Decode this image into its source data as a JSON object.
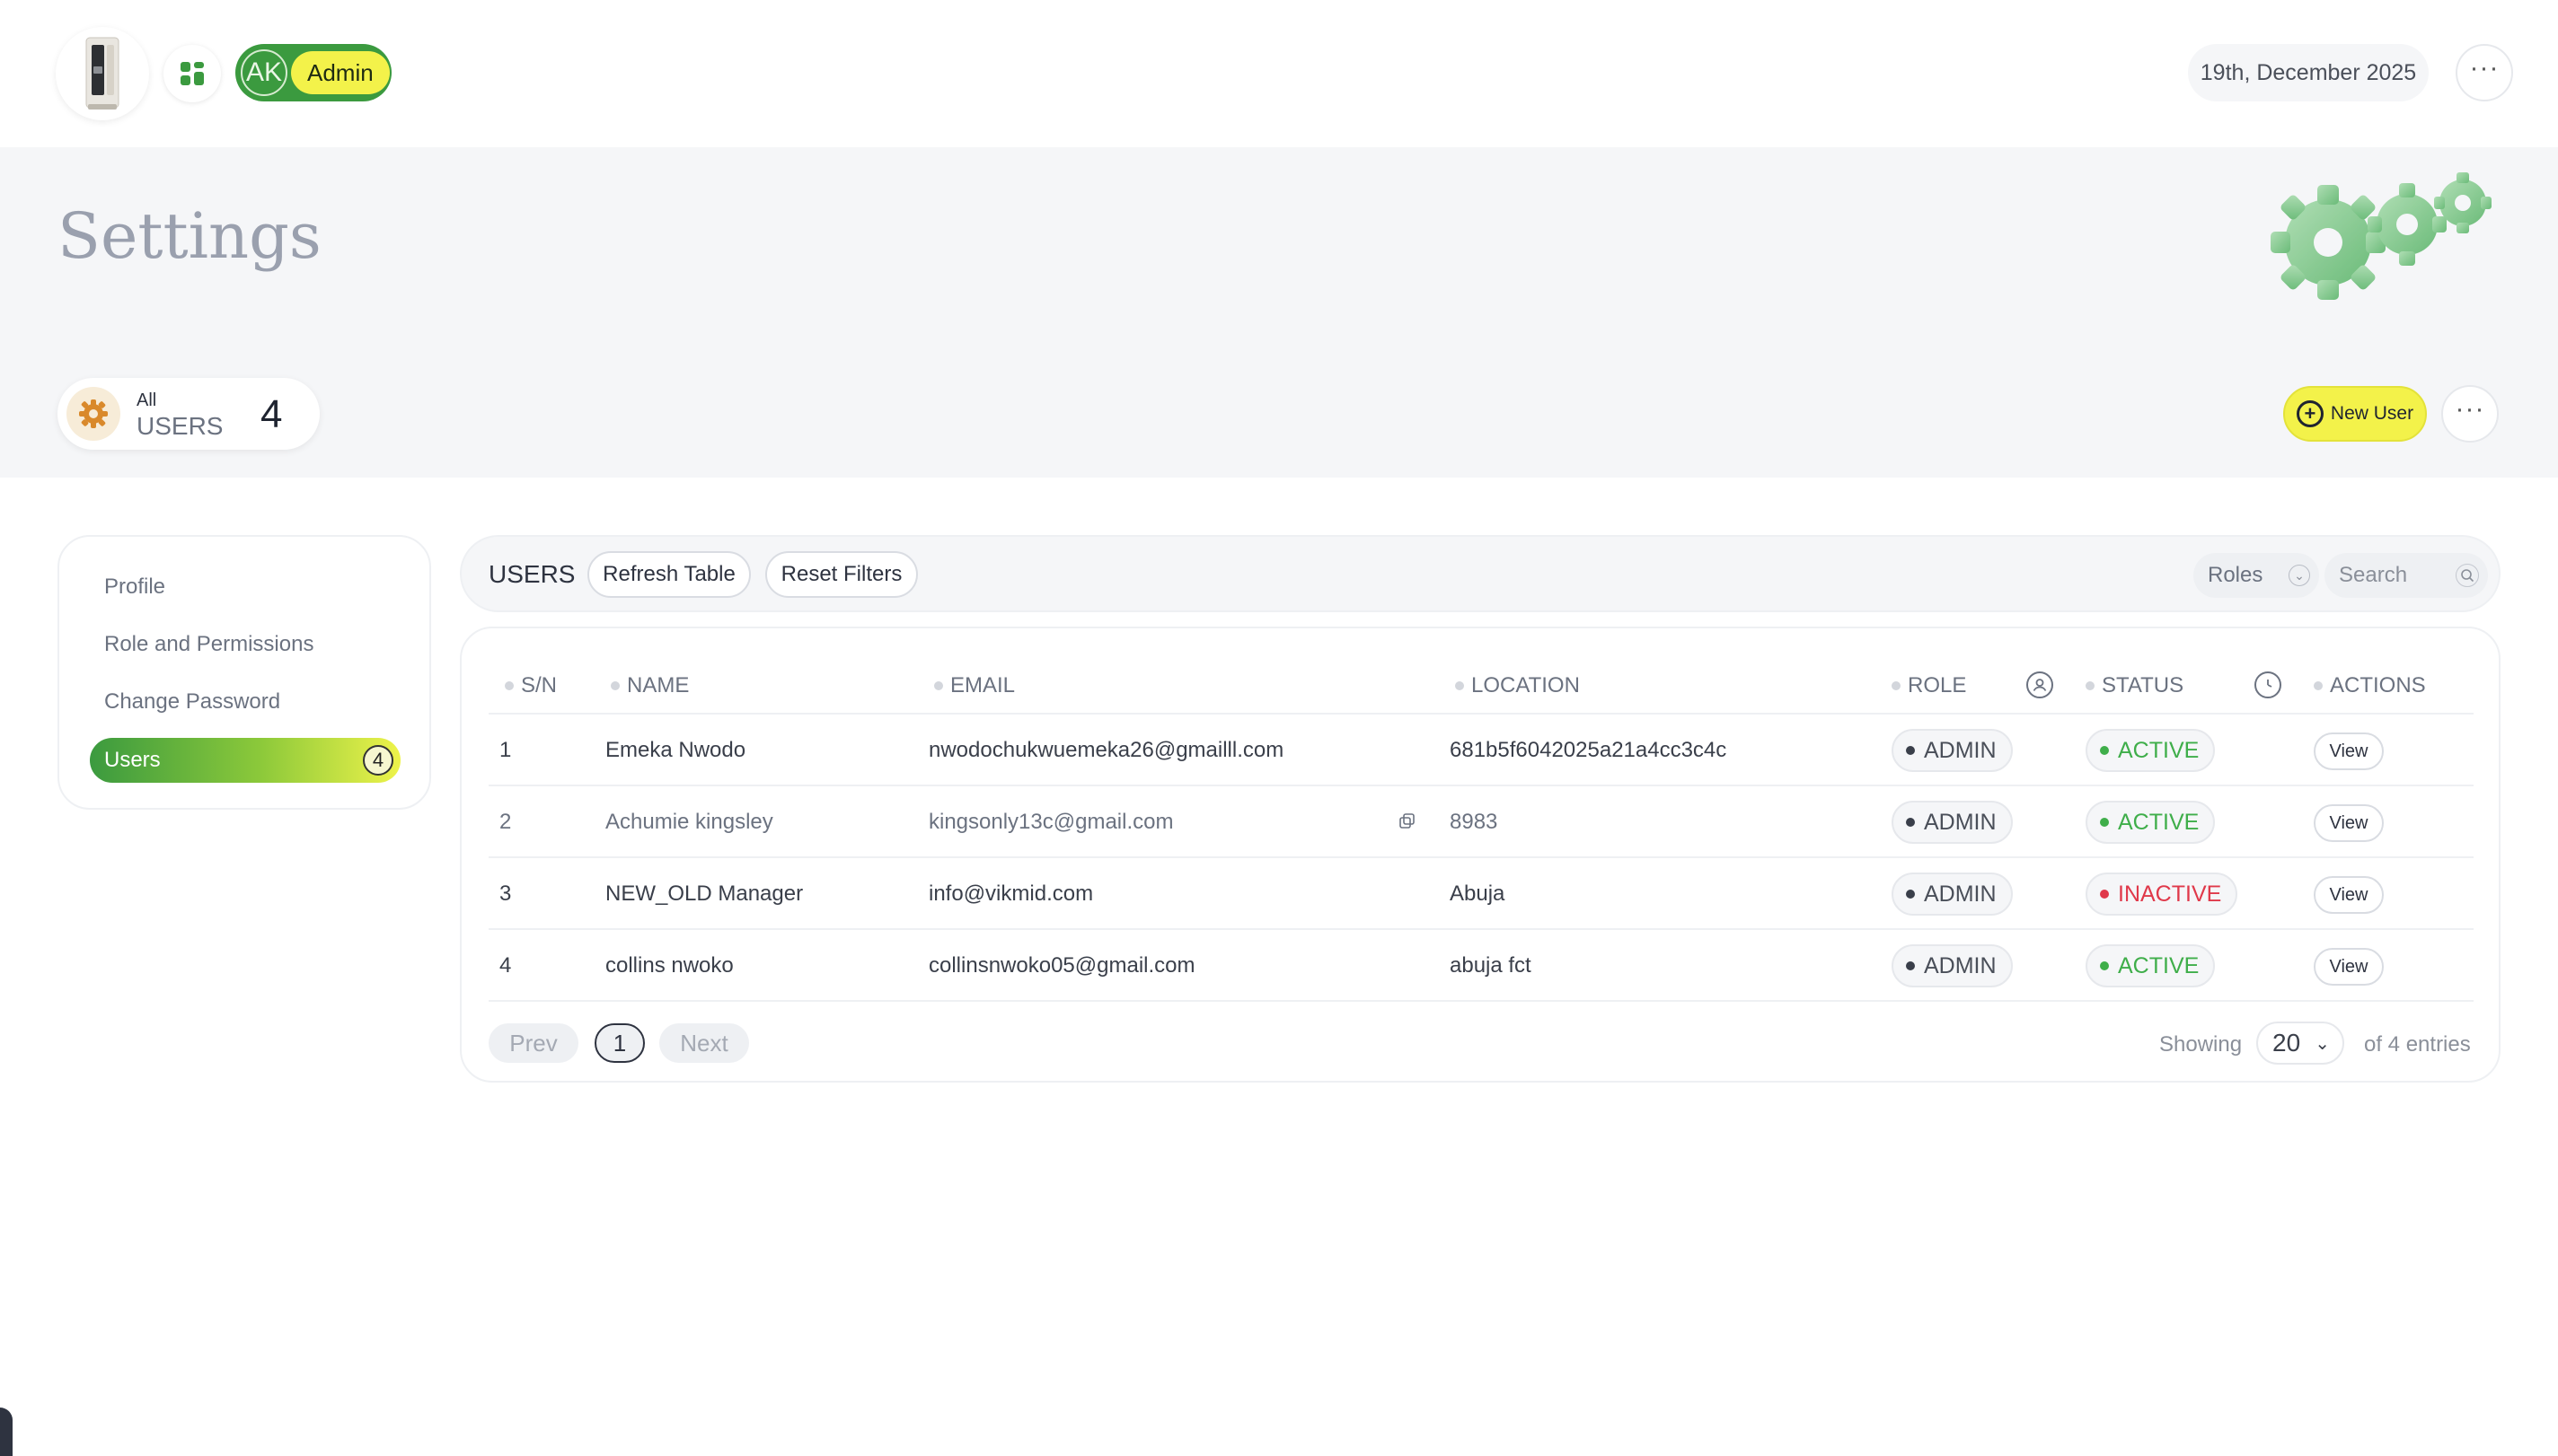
{
  "header": {
    "user_initials": "AK",
    "role_label": "Admin",
    "date": "19th, December 2025"
  },
  "hero": {
    "title": "Settings"
  },
  "summary": {
    "small_label": "All",
    "big_label": "USERS",
    "count": "4",
    "new_user_label": "New User"
  },
  "sidebar": {
    "items": [
      {
        "label": "Profile"
      },
      {
        "label": "Role and Permissions"
      },
      {
        "label": "Change Password"
      },
      {
        "label": "Users",
        "badge": "4",
        "active": true
      }
    ]
  },
  "toolbar": {
    "title": "USERS",
    "refresh_label": "Refresh Table",
    "reset_label": "Reset Filters",
    "roles_label": "Roles",
    "search_placeholder": "Search"
  },
  "table": {
    "columns": [
      "S/N",
      "NAME",
      "EMAIL",
      "LOCATION",
      "ROLE",
      "STATUS",
      "ACTIONS"
    ],
    "rows": [
      {
        "sn": "1",
        "name": "Emeka Nwodo",
        "email": "nwodochukwuemeka26@gmailll.com",
        "location": "681b5f6042025a21a4cc3c4c",
        "role": "ADMIN",
        "status": "ACTIVE",
        "action": "View"
      },
      {
        "sn": "2",
        "name": "Achumie kingsley",
        "email": "kingsonly13c@gmail.com",
        "location": "8983",
        "role": "ADMIN",
        "status": "ACTIVE",
        "action": "View"
      },
      {
        "sn": "3",
        "name": "NEW_OLD Manager",
        "email": "info@vikmid.com",
        "location": "Abuja",
        "role": "ADMIN",
        "status": "INACTIVE",
        "action": "View"
      },
      {
        "sn": "4",
        "name": "collins nwoko",
        "email": "collinsnwoko05@gmail.com",
        "location": "abuja fct",
        "role": "ADMIN",
        "status": "ACTIVE",
        "action": "View"
      }
    ]
  },
  "pagination": {
    "prev_label": "Prev",
    "current_page": "1",
    "next_label": "Next",
    "showing_label": "Showing",
    "per_page": "20",
    "entries_label": "of 4 entries"
  },
  "colors": {
    "brand_green": "#3b9a3f",
    "accent_yellow": "#f3f24a",
    "active_green": "#3fae4a",
    "inactive_red": "#e0394a"
  },
  "icons": {
    "logo": "water-dispenser-logo",
    "apps": "apps-grid-icon",
    "more": "more-dots-icon",
    "gears": "gears-illustration",
    "count": "gear-icon",
    "new_user": "plus-circle-icon",
    "roles_chevron": "chevron-down-icon",
    "search": "search-icon",
    "role_column": "user-circle-icon",
    "status_column": "clock-icon",
    "copy": "copy-icon"
  }
}
